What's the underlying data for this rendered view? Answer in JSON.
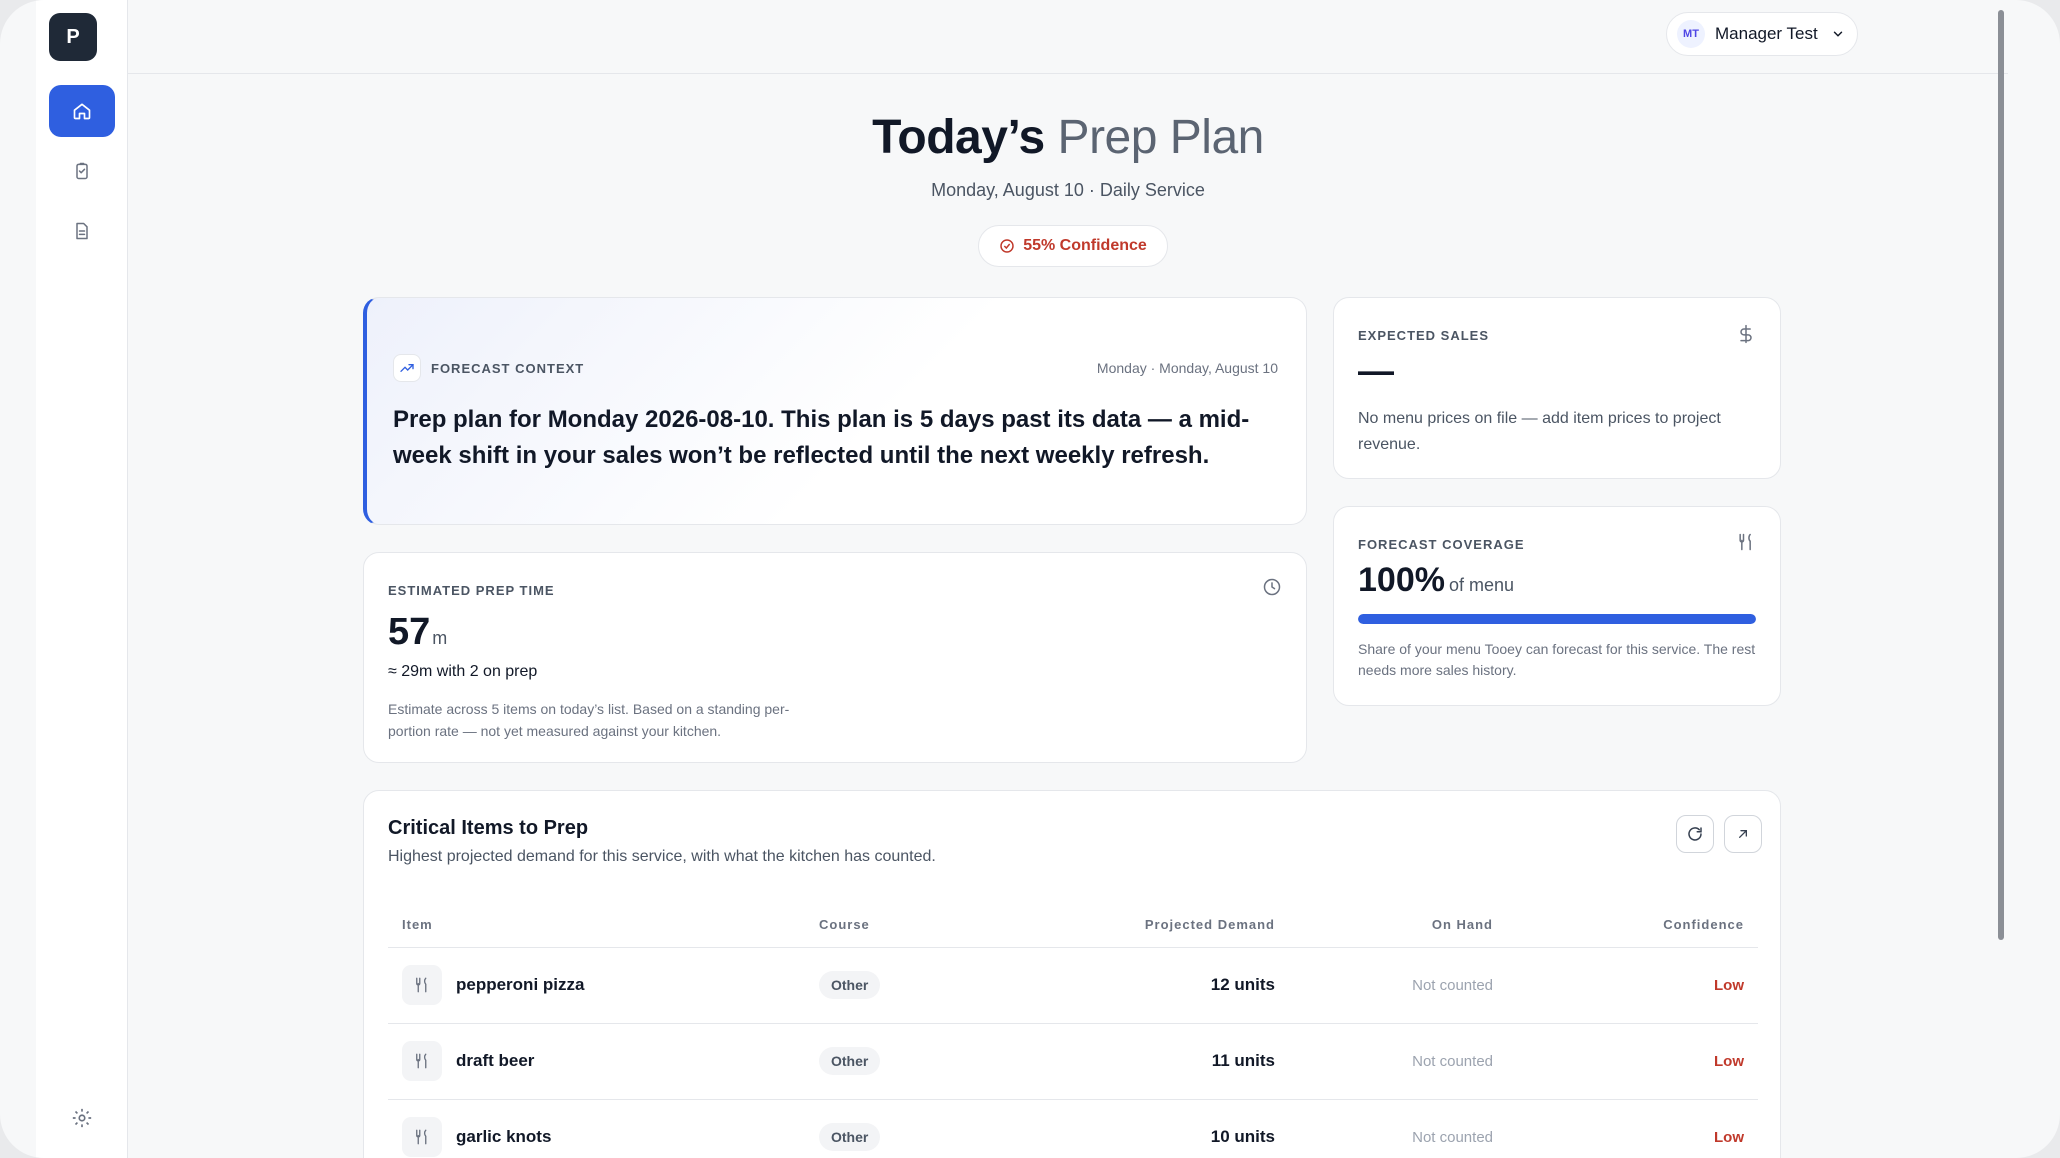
{
  "app": {
    "logo_letter": "P"
  },
  "sidebar": {
    "items": [
      {
        "name": "home",
        "icon": "home-icon",
        "active": true
      },
      {
        "name": "checklist",
        "icon": "clipboard-check-icon",
        "active": false
      },
      {
        "name": "documents",
        "icon": "document-icon",
        "active": false
      }
    ],
    "settings_icon": "gear-icon"
  },
  "header": {
    "user_initials": "MT",
    "user_name": "Manager Test"
  },
  "page": {
    "title_bold": "Today’s",
    "title_light": "Prep Plan",
    "subtitle": "Monday, August 10 · Daily Service",
    "confidence_label": "55% Confidence"
  },
  "forecast_context": {
    "label": "Forecast Context",
    "date": "Monday · Monday, August 10",
    "text": "Prep plan for Monday 2026-08-10. This plan is 5 days past its data — a mid-week shift in your sales won’t be reflected until the next weekly refresh."
  },
  "expected_sales": {
    "label": "Expected Sales",
    "value": "—",
    "note": "No menu prices on file — add item prices to project revenue."
  },
  "forecast_coverage": {
    "label": "Forecast Coverage",
    "value": "100%",
    "unit": "of menu",
    "fraction": 1.0,
    "note": "Share of your menu Tooey can forecast for this service. The rest needs more sales history."
  },
  "prep_time": {
    "label": "Estimated Prep Time",
    "value": "57",
    "unit": "m",
    "sub": "≈ 29m with 2 on prep",
    "note": "Estimate across 5 items on today’s list. Based on a standing per-portion rate — not yet measured against your kitchen."
  },
  "critical": {
    "title": "Critical Items to Prep",
    "subtitle": "Highest projected demand for this service, with what the kitchen has counted.",
    "columns": [
      "Item",
      "Course",
      "Projected Demand",
      "On Hand",
      "Confidence"
    ],
    "rows": [
      {
        "item": "pepperoni pizza",
        "course": "Other",
        "demand": "12 units",
        "on_hand": "Not counted",
        "confidence": "Low"
      },
      {
        "item": "draft beer",
        "course": "Other",
        "demand": "11 units",
        "on_hand": "Not counted",
        "confidence": "Low"
      },
      {
        "item": "garlic knots",
        "course": "Other",
        "demand": "10 units",
        "on_hand": "Not counted",
        "confidence": "Low"
      }
    ]
  },
  "colors": {
    "accent": "#2f5fe0",
    "danger": "#c0392b"
  }
}
